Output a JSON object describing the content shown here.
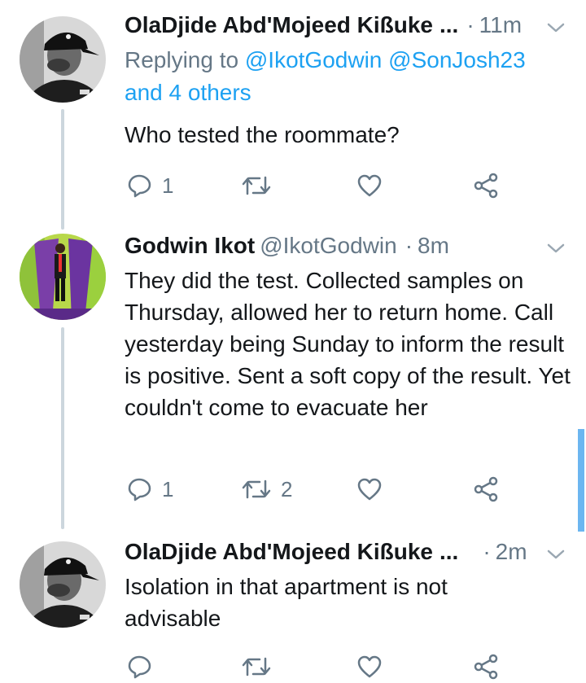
{
  "tweets": [
    {
      "name": "OlaDjide Abd'Mojeed Kißuke",
      "ellipsis": "...",
      "dot": "·",
      "time": "11m",
      "reply_prefix": "Replying to",
      "reply_handles": "@IkotGodwin @SonJosh23",
      "reply_others": "and 4 others",
      "text": "Who tested the roommate?",
      "reply_count": "1",
      "retweet_count": "",
      "like_count": ""
    },
    {
      "name": "Godwin Ikot",
      "handle": "@IkotGodwin",
      "dot": "·",
      "time": "8m",
      "text": "They did the test. Collected samples on Thursday,  allowed her to return home. Call yesterday being Sunday to inform the result is positive. Sent a soft copy of the result. Yet couldn't come to evacuate her",
      "reply_count": "1",
      "retweet_count": "2",
      "like_count": ""
    },
    {
      "name": "OlaDjide Abd'Mojeed Kißuke",
      "ellipsis": "...",
      "dot": "·",
      "time": "2m",
      "text": "Isolation in that apartment is not advisable",
      "reply_count": "",
      "retweet_count": "",
      "like_count": ""
    }
  ],
  "icons": {
    "reply": "reply-icon",
    "retweet": "retweet-icon",
    "like": "heart-icon",
    "share": "share-icon",
    "more": "chevron-down-icon"
  },
  "colors": {
    "text": "#14171a",
    "secondary": "#657786",
    "link": "#1da1f2",
    "thread_line": "#ccd6dd"
  }
}
